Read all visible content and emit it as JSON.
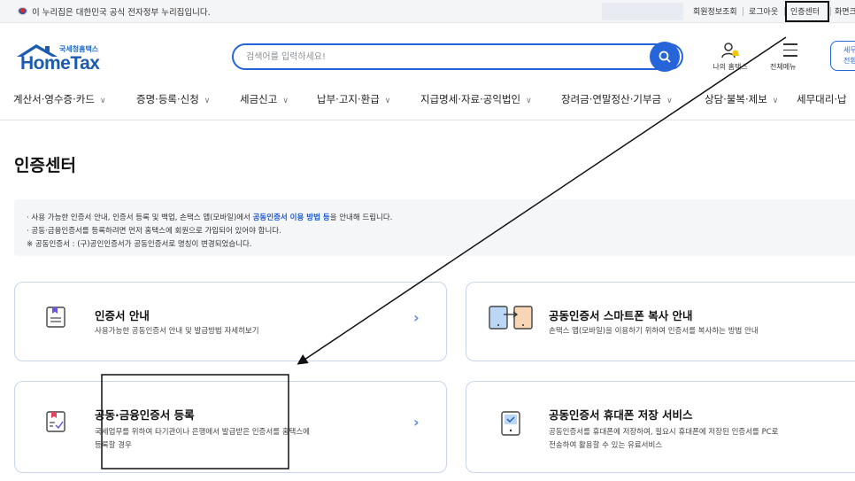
{
  "govbar": {
    "notice": "이 누리집은 대한민국 공식 전자정부 누리집입니다.",
    "links": [
      "회원정보조회",
      "로그아웃",
      "인증센터",
      "화면크"
    ]
  },
  "header": {
    "logo_small": "국세청홈택스",
    "logo_main": "HomeTax",
    "search_placeholder": "검색어를 입력하세요!",
    "my_home": "나의 홈택스",
    "all_menu": "전체메뉴",
    "tax_btn": "세무\n전환"
  },
  "nav": {
    "items": [
      "계산서·영수증·카드",
      "증명·등록·신청",
      "세금신고",
      "납부·고지·환급",
      "지급명세·자료·공익법인",
      "장려금·연말정산·기부금",
      "상담·불복·제보",
      "세무대리·납"
    ]
  },
  "page_title": "인증센터",
  "notice": {
    "line1_pre": "· 사용 가능한 인증서 안내, 인증서 등록 및 백업, 손택스 앱(모바일)에서 ",
    "line1_hl": "공동인증서 이용 방법 등",
    "line1_post": "을 안내해 드립니다.",
    "line2": "· 공동·금융인증서를 등록하려면 먼저 홈택스에 회원으로 가입되어 있어야 합니다.",
    "line3": "※ 공동인증서 : (구)공인인증서가 공동인증서로 명칭이 변경되었습니다."
  },
  "cards": [
    {
      "title": "인증서 안내",
      "desc": [
        "사용가능한 공동인증서 안내 및 발급방법 자세히보기"
      ],
      "icon": "document-icon"
    },
    {
      "title": "공동인증서 스마트폰 복사 안내",
      "desc": [
        "손택스 앱(모바일)을 이용하기 위하여 인증서를 복사하는 방법 안내"
      ],
      "icon": "phone-copy-icon"
    },
    {
      "title": "공동·금융인증서 등록",
      "desc": [
        "국세업무를 위하여 타기관이나 은행에서 발급받은 인증서를 홈택스에",
        "등록할 경우"
      ],
      "icon": "register-check-icon"
    },
    {
      "title": "공동인증서 휴대폰 저장 서비스",
      "desc": [
        "공동인증서를 휴대폰에 저장하여, 필요시 휴대폰에 저장된 인증서를 PC로",
        "전송하여 활용할 수 있는 유료서비스"
      ],
      "icon": "phone-save-icon"
    }
  ],
  "arrow_glyph": "›",
  "colors": {
    "accent": "#2565d9",
    "card_border": "#c9d6ea",
    "highlight": "#1b5bd6"
  }
}
